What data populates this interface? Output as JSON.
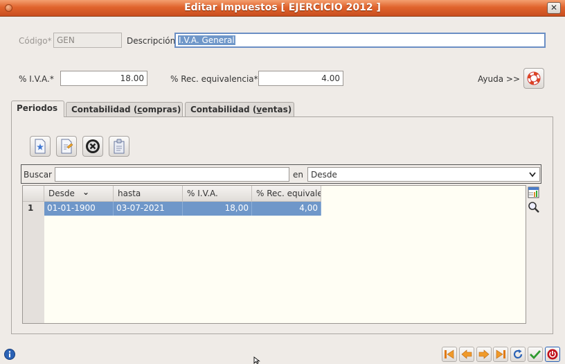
{
  "window": {
    "title": "Editar Impuestos [ EJERCICIO 2012 ]"
  },
  "form": {
    "codigo_label": "Código*",
    "codigo_value": "GEN",
    "descripcion_label": "Descripción",
    "descripcion_value": "I.V.A. General",
    "iva_label": "% I.V.A.*",
    "iva_value": "18.00",
    "rec_label": "% Rec. equivalencia*",
    "rec_value": "4.00",
    "ayuda_label": "Ayuda >>"
  },
  "tabs": [
    {
      "label_pre": "Periodos",
      "label_u": "",
      "label_post": ""
    },
    {
      "label_pre": "Contabilidad (",
      "label_u": "c",
      "label_post": "ompras)"
    },
    {
      "label_pre": "Contabilidad (",
      "label_u": "v",
      "label_post": "entas)"
    }
  ],
  "toolbar": {
    "icons": [
      "new-record-icon",
      "edit-record-icon",
      "delete-record-icon",
      "view-record-icon"
    ]
  },
  "search": {
    "label": "Buscar",
    "value": "",
    "in_label": "en",
    "field_selected": "Desde"
  },
  "table": {
    "columns": [
      "Desde",
      "hasta",
      "% I.V.A.",
      "% Rec. equivale"
    ],
    "sort_indicator": "⌄",
    "rows": [
      {
        "num": "1",
        "desde": "01-01-1900",
        "hasta": "03-07-2021",
        "iva": "18,00",
        "rec": "4,00"
      }
    ]
  },
  "colors": {
    "titlebar": "#e0642d",
    "selection": "#6f97c9",
    "grid_background": "#fffef4",
    "accept": "#2e9a2e",
    "cancel": "#c0101a",
    "info": "#2b62b5"
  }
}
